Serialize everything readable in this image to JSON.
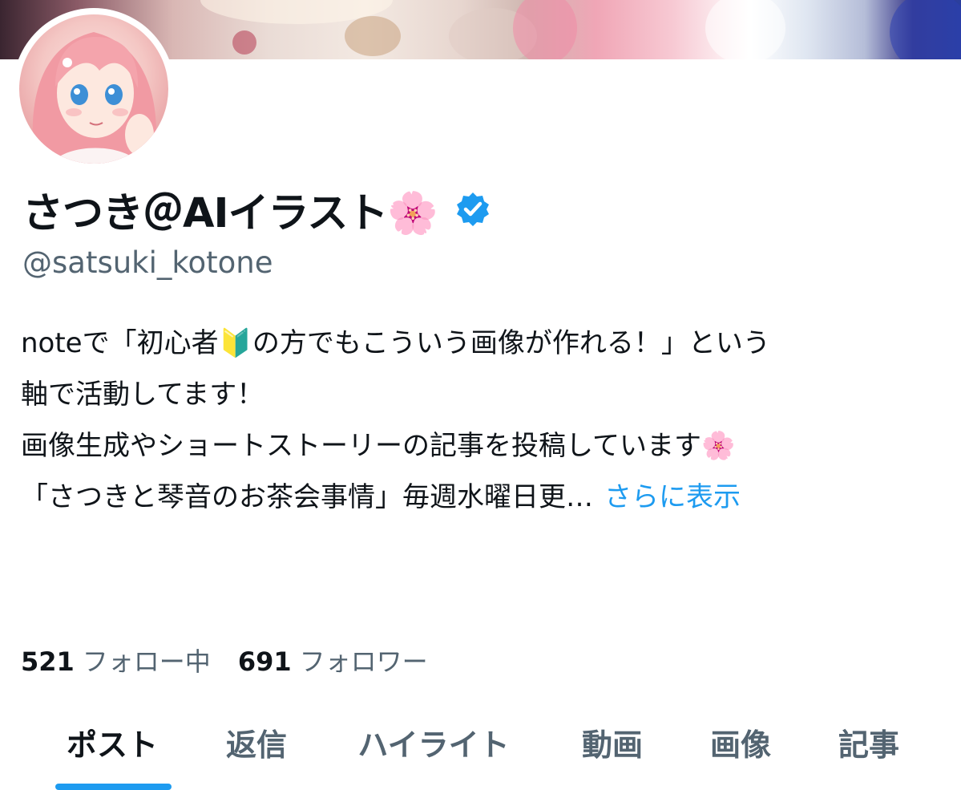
{
  "profile": {
    "display_name": "さつき＠AIイラスト🌸",
    "handle": "@satsuki_kotone",
    "verified": true
  },
  "bio": {
    "lines": [
      "noteで「初心者🔰の方でもこういう画像が作れる！」という",
      "軸で活動してます！",
      "画像生成やショートストーリーの記事を投稿しています🌸",
      "「さつきと琴音のお茶会事情」毎週水曜日更…"
    ],
    "show_more": "さらに表示"
  },
  "stats": {
    "following_count": "521",
    "following_label": "フォロー中",
    "followers_count": "691",
    "followers_label": "フォロワー"
  },
  "tabs": [
    {
      "label": "ポスト",
      "active": true
    },
    {
      "label": "返信",
      "active": false
    },
    {
      "label": "ハイライト",
      "active": false
    },
    {
      "label": "動画",
      "active": false
    },
    {
      "label": "画像",
      "active": false
    },
    {
      "label": "記事",
      "active": false
    }
  ],
  "colors": {
    "accent": "#1d9bf0",
    "text_primary": "#0f1419",
    "text_secondary": "#536471",
    "background": "#ffffff"
  },
  "icons": {
    "verified": "verified-badge-icon"
  }
}
